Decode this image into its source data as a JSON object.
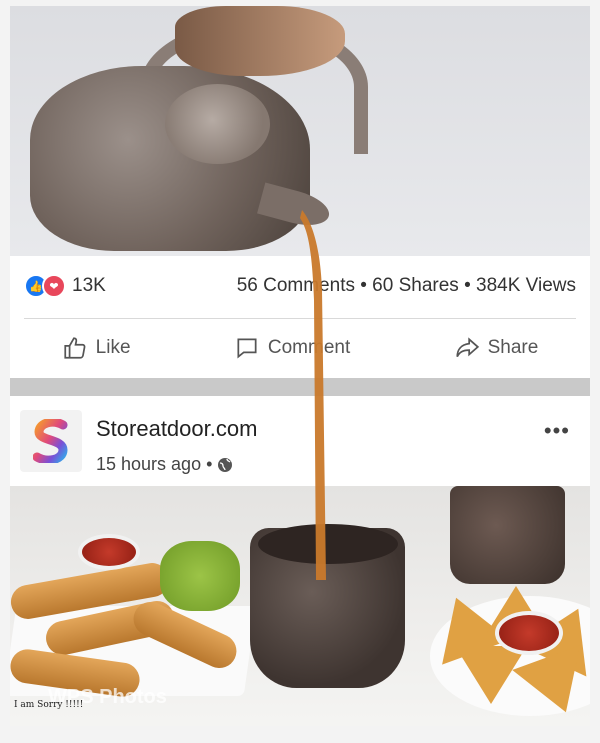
{
  "stats": {
    "reaction_count": "13K",
    "engagement": "56 Comments • 60 Shares • 384K Views"
  },
  "actions": {
    "like_label": "Like",
    "comment_label": "Comment",
    "share_label": "Share"
  },
  "post": {
    "page_name": "Storeatdoor.com",
    "timestamp": "15 hours ago •"
  },
  "image_overlay": {
    "watermark": "WPS Photos",
    "caption": "I am Sorry !!!!!"
  },
  "colors": {
    "like_blue": "#1877f2",
    "love_red": "#e8475b",
    "tea": "#c9792b"
  },
  "icons": [
    "like-reaction-icon",
    "love-reaction-icon",
    "thumbs-up-icon",
    "comment-icon",
    "share-icon",
    "globe-icon",
    "more-options-icon"
  ]
}
